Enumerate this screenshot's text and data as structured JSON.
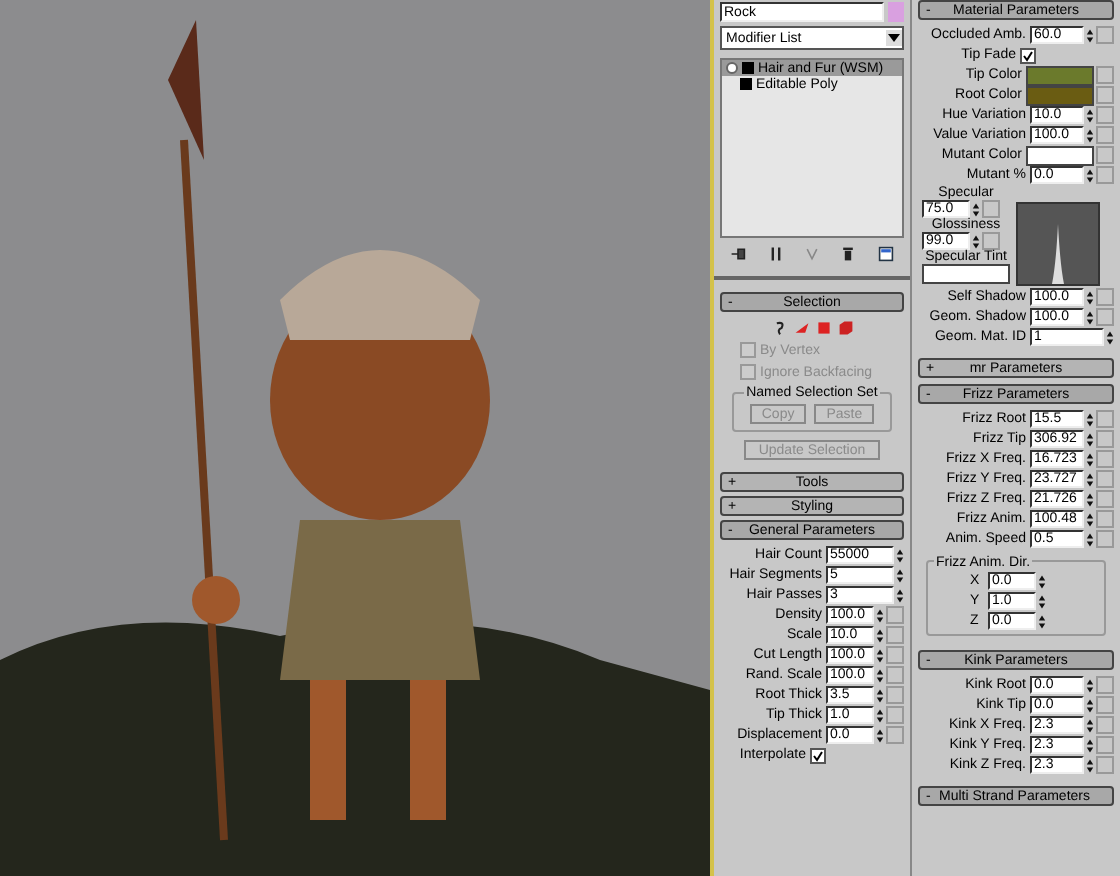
{
  "object": {
    "name": "Rock",
    "color": "#d9a0e0"
  },
  "modifier_list": "Modifier List",
  "stack": [
    {
      "label": "Hair and Fur (WSM)",
      "selected": true
    },
    {
      "label": "Editable Poly",
      "selected": false
    }
  ],
  "middle_rollouts": [
    {
      "title": "Selection",
      "sign": "-",
      "expanded": true,
      "rows": [
        {
          "kind": "icons"
        },
        {
          "kind": "option",
          "label": "By Vertex",
          "checked": false,
          "disabled": true
        },
        {
          "kind": "option",
          "label": "Ignore Backfacing",
          "checked": false,
          "disabled": true
        },
        {
          "kind": "buttongroup",
          "title": "Named Selection Set",
          "buttons": [
            {
              "label": "Copy",
              "disabled": true
            },
            {
              "label": "Paste",
              "disabled": true
            }
          ]
        },
        {
          "kind": "button",
          "label": "Update Selection",
          "disabled": true
        }
      ]
    },
    {
      "title": "Tools",
      "sign": "+",
      "expanded": false
    },
    {
      "title": "Styling",
      "sign": "+",
      "expanded": false
    },
    {
      "title": "General Parameters",
      "sign": "-",
      "expanded": true,
      "rows": [
        {
          "kind": "spinner",
          "label": "Hair Count",
          "value": "55000",
          "map_button": false
        },
        {
          "kind": "spinner",
          "label": "Hair Segments",
          "value": "5",
          "map_button": false
        },
        {
          "kind": "spinner",
          "label": "Hair Passes",
          "value": "3",
          "map_button": false
        },
        {
          "kind": "spinner",
          "label": "Density",
          "value": "100.0",
          "map_button": true
        },
        {
          "kind": "spinner",
          "label": "Scale",
          "value": "10.0",
          "map_button": true
        },
        {
          "kind": "spinner",
          "label": "Cut Length",
          "value": "100.0",
          "map_button": true
        },
        {
          "kind": "spinner",
          "label": "Rand. Scale",
          "value": "100.0",
          "map_button": true
        },
        {
          "kind": "spinner",
          "label": "Root Thick",
          "value": "3.5",
          "map_button": true
        },
        {
          "kind": "spinner",
          "label": "Tip Thick",
          "value": "1.0",
          "map_button": true
        },
        {
          "kind": "spinner",
          "label": "Displacement",
          "value": "0.0",
          "map_button": true
        },
        {
          "kind": "checkbox",
          "label": "Interpolate",
          "checked": true
        }
      ]
    }
  ],
  "right_rollouts": [
    {
      "title": "Material Parameters",
      "sign": "-",
      "expanded": true,
      "rows": [
        {
          "kind": "spinner",
          "label": "Occluded Amb.",
          "value": "60.0",
          "map_button": true
        },
        {
          "kind": "checkbox",
          "label": "Tip Fade",
          "checked": true
        },
        {
          "kind": "color",
          "label": "Tip Color",
          "color": "#6b7a2c",
          "map_button": true
        },
        {
          "kind": "color",
          "label": "Root Color",
          "color": "#6a5c12",
          "map_button": true
        },
        {
          "kind": "spinner",
          "label": "Hue Variation",
          "value": "10.0",
          "map_button": true
        },
        {
          "kind": "spinner",
          "label": "Value Variation",
          "value": "100.0",
          "map_button": true
        },
        {
          "kind": "color",
          "label": "Mutant Color",
          "color": "#ffffff",
          "map_button": true
        },
        {
          "kind": "spinner",
          "label": "Mutant %",
          "value": "0.0",
          "map_button": true
        },
        {
          "kind": "specular",
          "specular_label": "Specular",
          "specular": "75.0",
          "glossiness_label": "Glossiness",
          "glossiness": "99.0",
          "tint": {
            "label": "Specular Tint",
            "color": "#ffffff"
          }
        },
        {
          "kind": "spinner",
          "label": "Self Shadow",
          "value": "100.0",
          "map_button": true
        },
        {
          "kind": "spinner",
          "label": "Geom. Shadow",
          "value": "100.0",
          "map_button": true
        },
        {
          "kind": "spinner",
          "label": "Geom. Mat. ID",
          "value": "1",
          "map_button": false
        }
      ]
    },
    {
      "title": "mr Parameters",
      "sign": "+",
      "expanded": false
    },
    {
      "title": "Frizz Parameters",
      "sign": "-",
      "expanded": true,
      "rows": [
        {
          "kind": "spinner",
          "label": "Frizz Root",
          "value": "15.5",
          "map_button": true
        },
        {
          "kind": "spinner",
          "label": "Frizz Tip",
          "value": "306.92",
          "map_button": true
        },
        {
          "kind": "spinner",
          "label": "Frizz X Freq.",
          "value": "16.723",
          "map_button": true
        },
        {
          "kind": "spinner",
          "label": "Frizz Y Freq.",
          "value": "23.727",
          "map_button": true
        },
        {
          "kind": "spinner",
          "label": "Frizz Z Freq.",
          "value": "21.726",
          "map_button": true
        },
        {
          "kind": "spinner",
          "label": "Frizz Anim.",
          "value": "100.48",
          "map_button": true
        },
        {
          "kind": "spinner",
          "label": "Anim. Speed",
          "value": "0.5",
          "map_button": true
        },
        {
          "kind": "group",
          "title": "Frizz Anim. Dir.",
          "rows": [
            {
              "label": "X",
              "value": "0.0"
            },
            {
              "label": "Y",
              "value": "1.0"
            },
            {
              "label": "Z",
              "value": "0.0"
            }
          ]
        }
      ]
    },
    {
      "title": "Kink Parameters",
      "sign": "-",
      "expanded": true,
      "rows": [
        {
          "kind": "spinner",
          "label": "Kink Root",
          "value": "0.0",
          "map_button": true
        },
        {
          "kind": "spinner",
          "label": "Kink Tip",
          "value": "0.0",
          "map_button": true
        },
        {
          "kind": "spinner",
          "label": "Kink X Freq.",
          "value": "2.3",
          "map_button": true
        },
        {
          "kind": "spinner",
          "label": "Kink Y Freq.",
          "value": "2.3",
          "map_button": true
        },
        {
          "kind": "spinner",
          "label": "Kink Z Freq.",
          "value": "2.3",
          "map_button": true
        }
      ]
    },
    {
      "title": "Multi Strand Parameters",
      "sign": "-",
      "expanded": true
    }
  ]
}
